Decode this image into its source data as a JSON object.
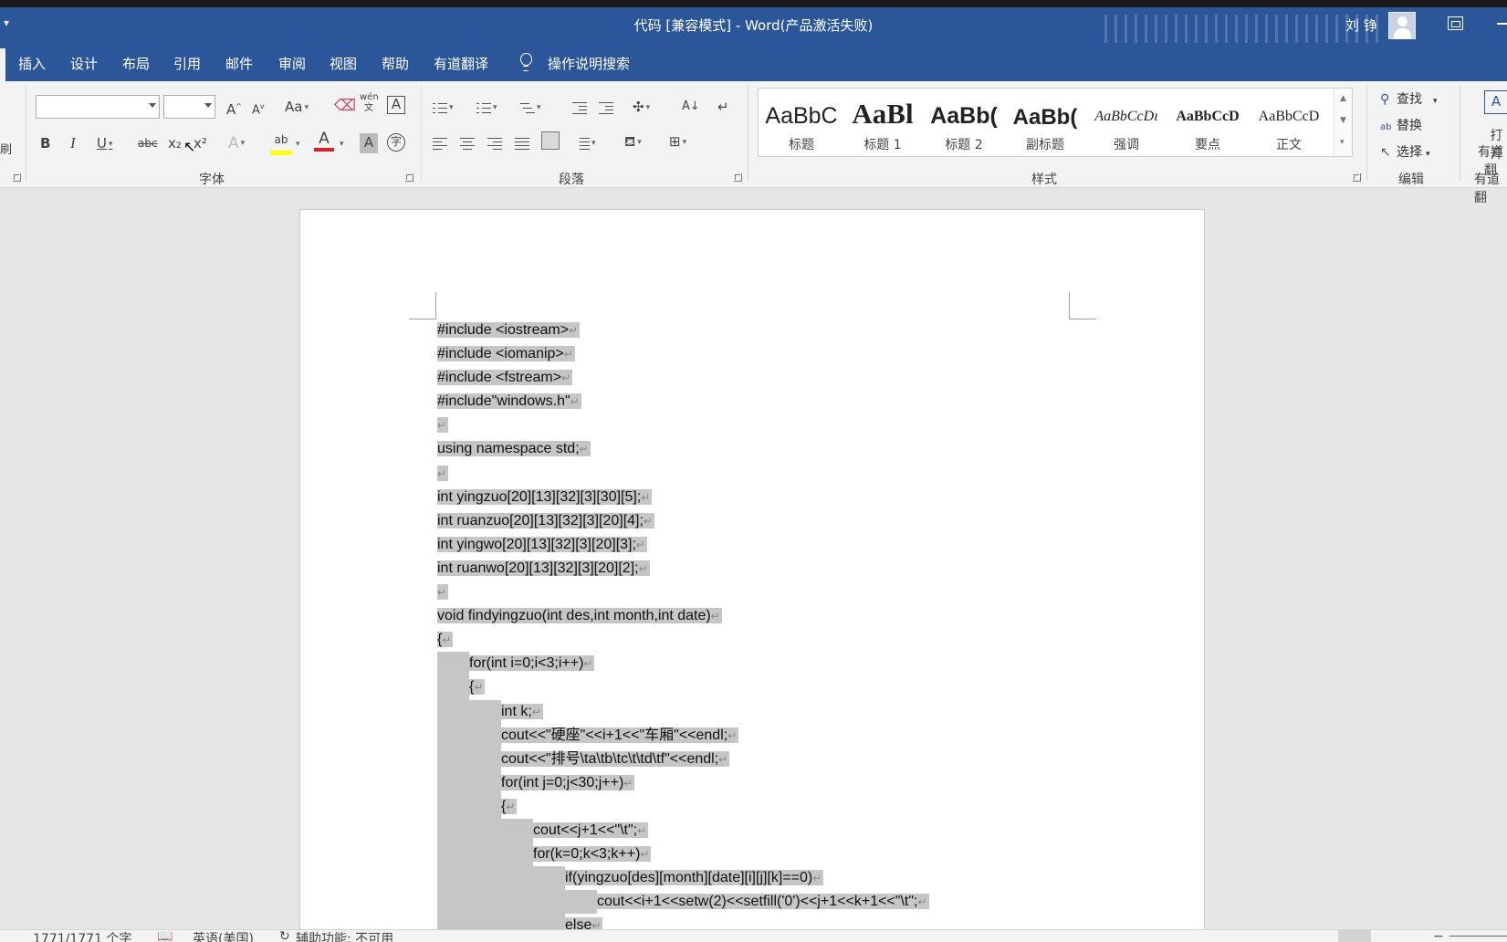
{
  "titlebar": {
    "quick_access": "▾",
    "document_title": "代码 [兼容模式]  -  Word(产品激活失败)",
    "user_name": "刘 铮"
  },
  "tabs": [
    "插入",
    "设计",
    "布局",
    "引用",
    "邮件",
    "审阅",
    "视图",
    "帮助",
    "有道翻译"
  ],
  "tell_me": "操作说明搜索",
  "ribbon": {
    "font_group_label": "字体",
    "paragraph_group_label": "段落",
    "styles_group_label": "样式",
    "edit_group_label": "编辑",
    "youdao_group_label": "有道翻",
    "clipboard_fragment": "刷",
    "font_name": "",
    "font_size": "",
    "grow_font": "A",
    "shrink_font": "A",
    "change_case": "Aa",
    "phonetic": "wén",
    "bold": "B",
    "italic": "I",
    "underline": "U",
    "strike": "abc",
    "subscript": "x₂",
    "superscript": "x²",
    "font_color_letter": "A",
    "highlight_letter": "ab",
    "sort": "A↓",
    "styles": [
      {
        "sample": "AaBbC",
        "label": "标题"
      },
      {
        "sample": "AaBl",
        "label": "标题 1"
      },
      {
        "sample": "AaBb(",
        "label": "标题 2"
      },
      {
        "sample": "AaBb(",
        "label": "副标题"
      },
      {
        "sample": "AaBbCcDı",
        "label": "强调"
      },
      {
        "sample": "AaBbCcD",
        "label": "要点"
      },
      {
        "sample": "AaBbCcD",
        "label": "正文"
      }
    ],
    "find": "查找",
    "replace": "替换",
    "select": "选择",
    "youdao_open": "打开",
    "youdao_sub": "有道翻"
  },
  "document": {
    "lines": [
      "#include <iostream>",
      "#include <iomanip>",
      "#include <fstream>",
      "#include\"windows.h\"",
      "",
      "using namespace std;",
      "",
      "int yingzuo[20][13][32][3][30][5];",
      "int ruanzuo[20][13][32][3][20][4];",
      "int yingwo[20][13][32][3][20][3];",
      "int ruanwo[20][13][32][3][20][2];",
      "",
      "void findyingzuo(int des,int month,int date)",
      "{",
      "for(int i=0;i<3;i++)",
      "{",
      "int k;",
      "cout<<\"硬座\"<<i+1<<\"车厢\"<<endl;",
      "cout<<\"排号\\ta\\tb\\tc\\t\\td\\tf\"<<endl;",
      "for(int j=0;j<30;j++)",
      "{",
      "cout<<j+1<<\"\\t\";",
      "for(k=0;k<3;k++)",
      "if(yingzuo[des][month][date][i][j][k]==0)",
      "cout<<i+1<<setw(2)<<setfill('0')<<j+1<<k+1<<\"\\t\";",
      "else"
    ],
    "indents": [
      0,
      0,
      0,
      0,
      0,
      0,
      0,
      0,
      0,
      0,
      0,
      0,
      0,
      0,
      1,
      1,
      2,
      2,
      2,
      2,
      2,
      3,
      3,
      4,
      5,
      4
    ]
  },
  "statusbar": {
    "word_count": "1771/1771 个字",
    "language": "英语(美国)",
    "accessibility": "辅助功能: 不可用"
  },
  "colors": {
    "accent": "#2b579a",
    "selection": "#c6c6c6",
    "font_color_bar": "#e02020",
    "highlight_bar": "#ffff00"
  }
}
